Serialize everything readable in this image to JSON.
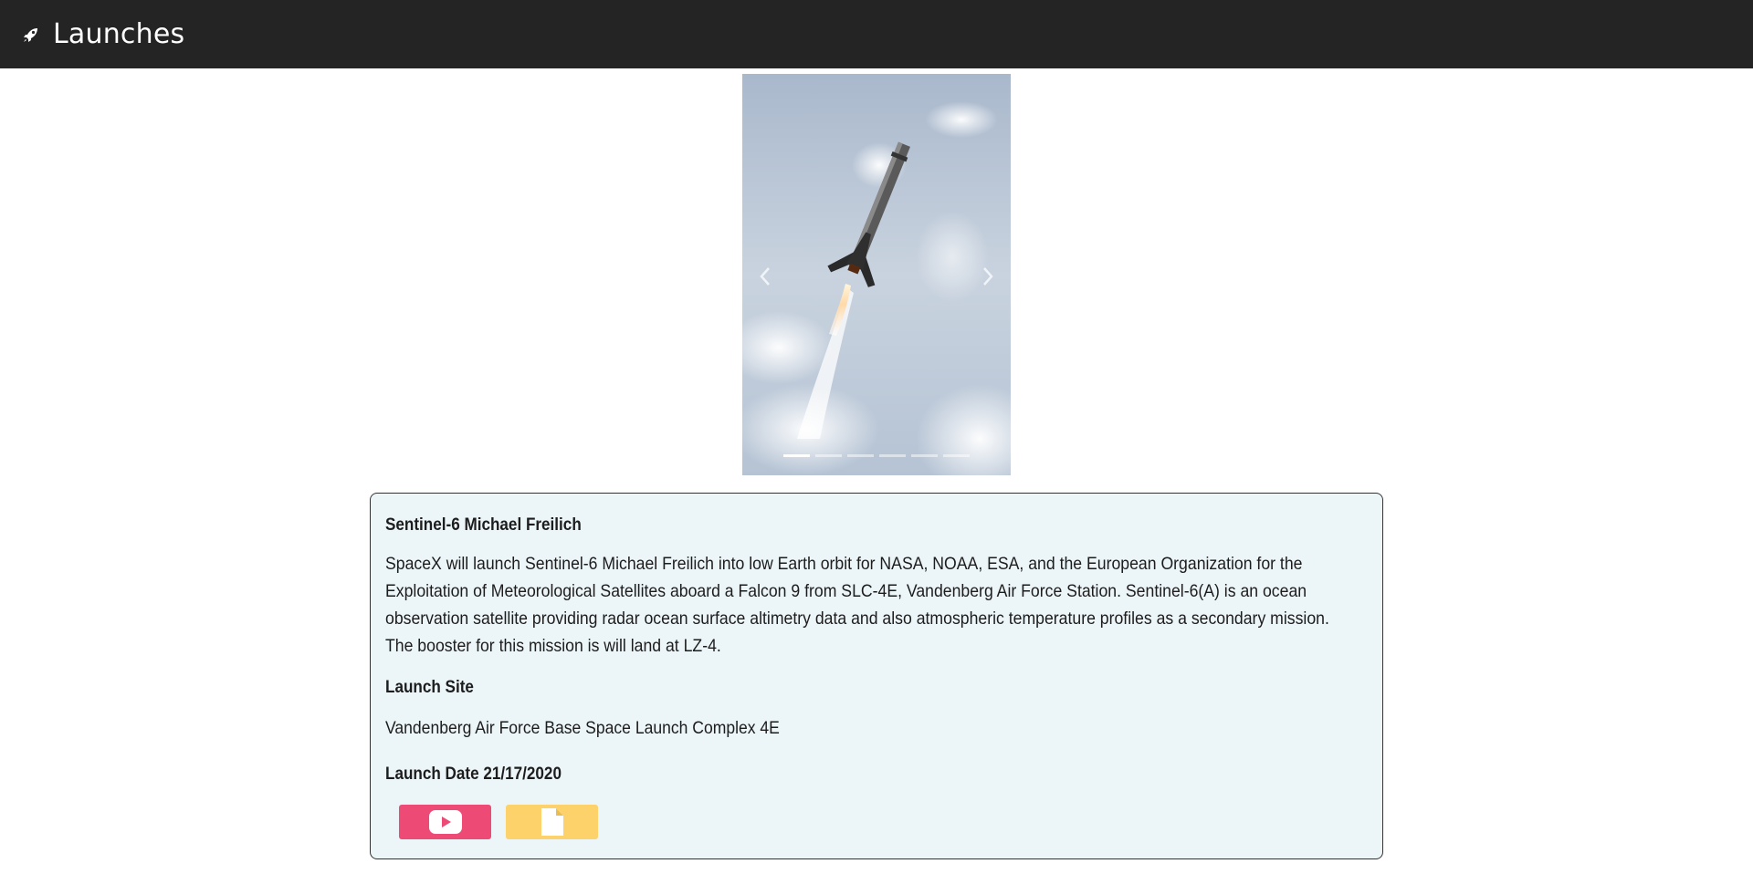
{
  "navbar": {
    "title": "Launches",
    "icon": "rocket-icon"
  },
  "carousel": {
    "slide_count": 6,
    "active_index": 0,
    "prev_icon": "chevron-left-icon",
    "next_icon": "chevron-right-icon"
  },
  "launch": {
    "mission_name": "Sentinel-6 Michael Freilich",
    "description": "SpaceX will launch Sentinel-6 Michael Freilich into low Earth orbit for NASA, NOAA, ESA, and the European Organization for the Exploitation of Meteorological Satellites aboard a Falcon 9 from SLC-4E, Vandenberg Air Force Station. Sentinel-6(A) is an ocean observation satellite providing radar ocean surface altimetry data and also atmospheric temperature profiles as a secondary mission. The booster for this mission is will land at LZ-4.",
    "launch_site_heading": "Launch Site",
    "launch_site": "Vandenberg Air Force Base Space Launch Complex 4E",
    "launch_date": "Launch Date 21/17/2020"
  },
  "buttons": {
    "youtube_icon": "youtube-icon",
    "article_icon": "document-icon"
  },
  "colors": {
    "navbar_bg": "#242424",
    "card_bg": "#ecf5f8",
    "youtube_btn": "#ee4a76",
    "article_btn": "#fdd26a"
  }
}
